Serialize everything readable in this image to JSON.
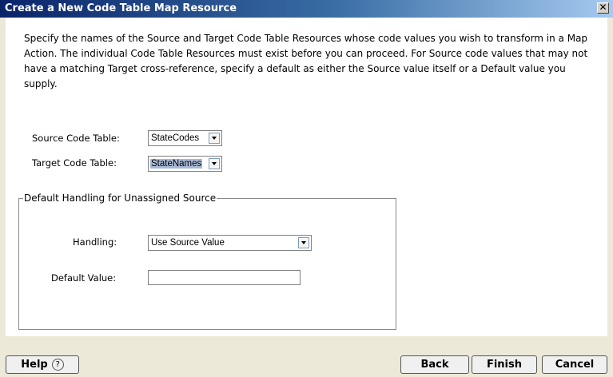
{
  "window": {
    "title": "Create a New Code Table Map Resource",
    "close_glyph": "✕"
  },
  "instructions": "Specify the names of the Source and Target Code Table Resources whose code values you wish to transform in a Map Action.  The individual Code Table Resources must exist before you can proceed.  For Source code values that may not have a matching Target cross-reference, specify a default as either the Source value itself or a Default value you supply.",
  "fields": {
    "source_label": "Source Code Table:",
    "source_value": "StateCodes",
    "target_label": "Target Code Table:",
    "target_value": "StateNames"
  },
  "default_handling": {
    "legend": "Default Handling for Unassigned Source",
    "handling_label": "Handling:",
    "handling_value": "Use Source Value",
    "default_value_label": "Default Value:",
    "default_value": ""
  },
  "buttons": {
    "help": "Help",
    "help_icon": "?",
    "back": "Back",
    "finish": "Finish",
    "cancel": "Cancel"
  },
  "icons": {
    "close": "close-icon",
    "dropdown": "chevron-down-icon",
    "help": "help-icon"
  },
  "colors": {
    "title_bar_start": "#0a246a",
    "title_bar_end": "#a6caf0",
    "dialog_bg": "#ece9d8",
    "content_bg": "#ffffff",
    "selection": "#a8b9d8"
  }
}
